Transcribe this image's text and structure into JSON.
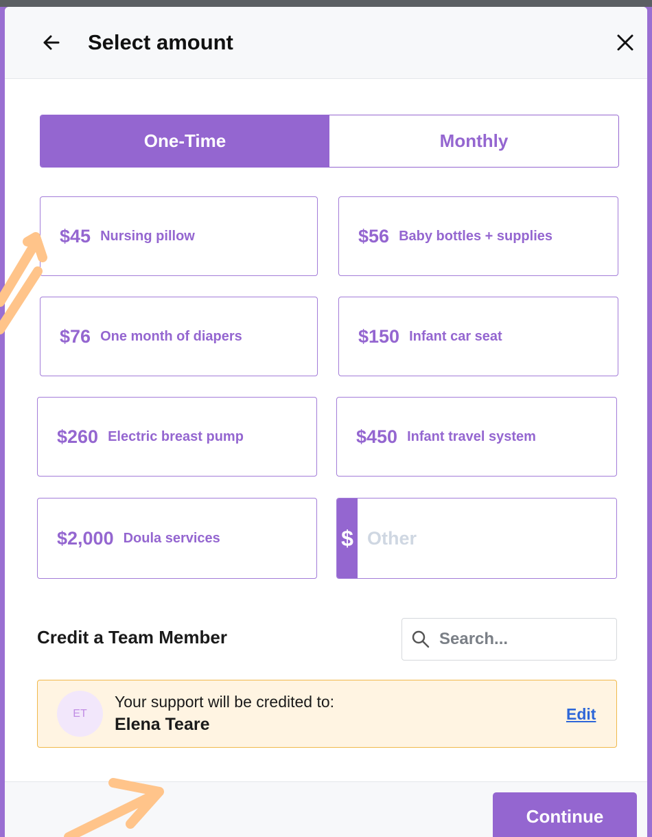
{
  "header": {
    "title": "Select amount",
    "back_icon": "arrow-left-icon",
    "close_icon": "close-icon"
  },
  "frequency": {
    "options": [
      {
        "label": "One-Time",
        "active": true
      },
      {
        "label": "Monthly",
        "active": false
      }
    ]
  },
  "amounts": [
    {
      "price": "$45",
      "desc": "Nursing pillow"
    },
    {
      "price": "$56",
      "desc": "Baby bottles + supplies"
    },
    {
      "price": "$76",
      "desc": "One month of diapers"
    },
    {
      "price": "$150",
      "desc": "Infant car seat"
    },
    {
      "price": "$260",
      "desc": "Electric breast pump"
    },
    {
      "price": "$450",
      "desc": "Infant travel system"
    },
    {
      "price": "$2,000",
      "desc": "Doula services"
    }
  ],
  "other": {
    "symbol": "$",
    "placeholder": "Other",
    "value": ""
  },
  "credit": {
    "label": "Credit a Team Member",
    "search_placeholder": "Search...",
    "line": "Your support will be credited to:",
    "initials": "ET",
    "name": "Elena Teare",
    "edit_label": "Edit"
  },
  "footer": {
    "continue_label": "Continue"
  },
  "colors": {
    "accent": "#9466d0",
    "credit_bg": "#fff4e2",
    "credit_border": "#f0b84a",
    "link": "#2d66d8",
    "annotation": "#ffc48a"
  }
}
